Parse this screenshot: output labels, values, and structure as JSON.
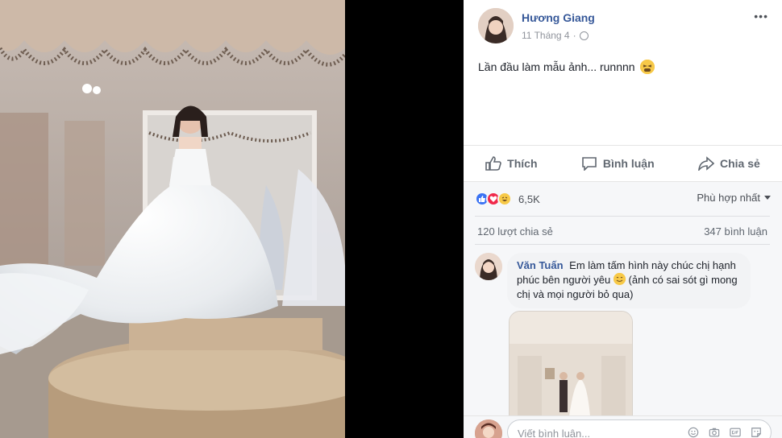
{
  "post": {
    "author": "Hương Giang",
    "date": "11 Tháng 4",
    "separator": "·",
    "more_label": "•••",
    "text": "Lần đầu làm mẫu ảnh... runnnn"
  },
  "actions": {
    "like": "Thích",
    "comment": "Bình luận",
    "share": "Chia sẻ"
  },
  "reactions": {
    "count": "6,5K",
    "types": [
      "like-icon",
      "love-icon",
      "haha-icon"
    ],
    "colors": {
      "like": "#3b73f3",
      "love": "#f0284a",
      "haha": "#f7c948"
    }
  },
  "sort": {
    "label": "Phù hợp nhất"
  },
  "stats": {
    "shares": "120 lượt chia sẻ",
    "comments": "347 bình luận"
  },
  "comment": {
    "author": "Văn Tuấn",
    "text_part1": "Em làm tấm hình này chúc chị hạnh phúc bên người yêu",
    "text_part2": "(ảnh có sai sót gì mong chị và mọi người bỏ qua)"
  },
  "compose": {
    "placeholder": "Viết bình luận...",
    "icons": [
      "emoji-icon",
      "camera-icon",
      "gif-icon",
      "sticker-icon"
    ]
  },
  "colors": {
    "link": "#365899",
    "text": "#1d2129",
    "muted": "#90949c"
  }
}
